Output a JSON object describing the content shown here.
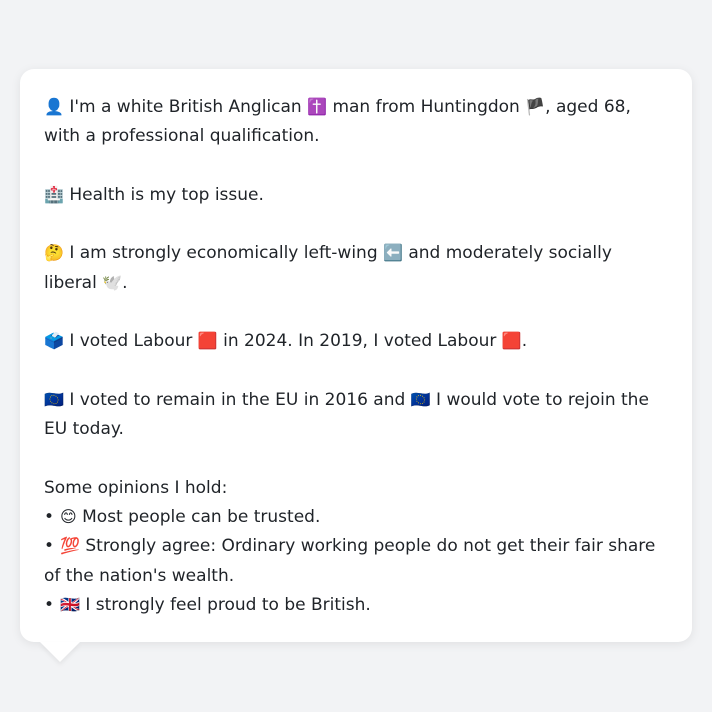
{
  "profile": {
    "p1": {
      "icon": "👤",
      "t1": " I'm a white British Anglican ",
      "icon_religion": "✝️",
      "t2": " man from Huntingdon ",
      "icon_flag": "🏴",
      "t3": ", aged 68, with a professional qualification."
    },
    "p2": {
      "icon": "🏥",
      "text": " Health is my top issue."
    },
    "p3": {
      "icon": "🤔",
      "t1": " I am strongly economically left-wing ",
      "icon_left": "⬅️",
      "t2": " and moderately socially liberal ",
      "icon_dove": "🕊️",
      "t3": "."
    },
    "p4": {
      "icon": "🗳️",
      "t1": " I voted Labour ",
      "icon_red1": "🟥",
      "t2": " in 2024. In 2019, I voted Labour ",
      "icon_red2": "🟥",
      "t3": "."
    },
    "p5": {
      "icon": "🇪🇺",
      "t1": " I voted to remain in the EU in 2016 and ",
      "icon_eu2": "🇪🇺",
      "t2": " I would vote to rejoin the EU today."
    },
    "opinions_heading": "Some opinions I hold:",
    "opinions": [
      {
        "bullet": "•",
        "icon": "😊",
        "text": " Most people can be trusted."
      },
      {
        "bullet": "•",
        "icon": "💯",
        "text": " Strongly agree: Ordinary working people do not get their fair share of the nation's wealth."
      },
      {
        "bullet": "•",
        "icon": "🇬🇧",
        "text": " I strongly feel proud to be British."
      }
    ]
  }
}
